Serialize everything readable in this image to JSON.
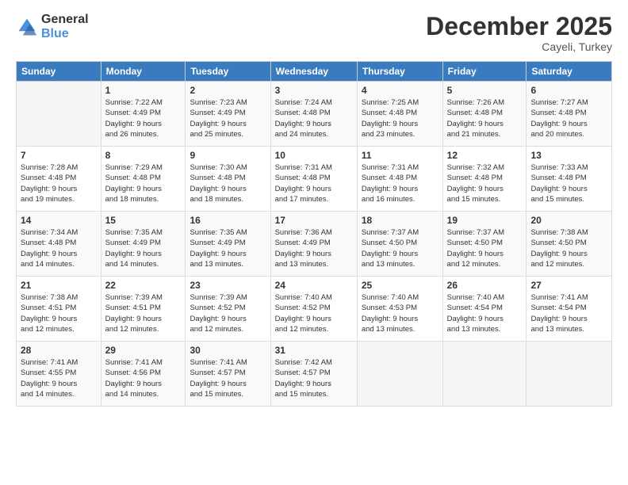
{
  "logo": {
    "general": "General",
    "blue": "Blue"
  },
  "header": {
    "title": "December 2025",
    "location": "Cayeli, Turkey"
  },
  "columns": [
    "Sunday",
    "Monday",
    "Tuesday",
    "Wednesday",
    "Thursday",
    "Friday",
    "Saturday"
  ],
  "weeks": [
    [
      {
        "day": "",
        "sunrise": "",
        "sunset": "",
        "daylight": ""
      },
      {
        "day": "1",
        "sunrise": "7:22 AM",
        "sunset": "4:49 PM",
        "daylight": "9 hours and 26 minutes."
      },
      {
        "day": "2",
        "sunrise": "7:23 AM",
        "sunset": "4:49 PM",
        "daylight": "9 hours and 25 minutes."
      },
      {
        "day": "3",
        "sunrise": "7:24 AM",
        "sunset": "4:48 PM",
        "daylight": "9 hours and 24 minutes."
      },
      {
        "day": "4",
        "sunrise": "7:25 AM",
        "sunset": "4:48 PM",
        "daylight": "9 hours and 23 minutes."
      },
      {
        "day": "5",
        "sunrise": "7:26 AM",
        "sunset": "4:48 PM",
        "daylight": "9 hours and 21 minutes."
      },
      {
        "day": "6",
        "sunrise": "7:27 AM",
        "sunset": "4:48 PM",
        "daylight": "9 hours and 20 minutes."
      }
    ],
    [
      {
        "day": "7",
        "sunrise": "7:28 AM",
        "sunset": "4:48 PM",
        "daylight": "9 hours and 19 minutes."
      },
      {
        "day": "8",
        "sunrise": "7:29 AM",
        "sunset": "4:48 PM",
        "daylight": "9 hours and 18 minutes."
      },
      {
        "day": "9",
        "sunrise": "7:30 AM",
        "sunset": "4:48 PM",
        "daylight": "9 hours and 18 minutes."
      },
      {
        "day": "10",
        "sunrise": "7:31 AM",
        "sunset": "4:48 PM",
        "daylight": "9 hours and 17 minutes."
      },
      {
        "day": "11",
        "sunrise": "7:31 AM",
        "sunset": "4:48 PM",
        "daylight": "9 hours and 16 minutes."
      },
      {
        "day": "12",
        "sunrise": "7:32 AM",
        "sunset": "4:48 PM",
        "daylight": "9 hours and 15 minutes."
      },
      {
        "day": "13",
        "sunrise": "7:33 AM",
        "sunset": "4:48 PM",
        "daylight": "9 hours and 15 minutes."
      }
    ],
    [
      {
        "day": "14",
        "sunrise": "7:34 AM",
        "sunset": "4:48 PM",
        "daylight": "9 hours and 14 minutes."
      },
      {
        "day": "15",
        "sunrise": "7:35 AM",
        "sunset": "4:49 PM",
        "daylight": "9 hours and 14 minutes."
      },
      {
        "day": "16",
        "sunrise": "7:35 AM",
        "sunset": "4:49 PM",
        "daylight": "9 hours and 13 minutes."
      },
      {
        "day": "17",
        "sunrise": "7:36 AM",
        "sunset": "4:49 PM",
        "daylight": "9 hours and 13 minutes."
      },
      {
        "day": "18",
        "sunrise": "7:37 AM",
        "sunset": "4:50 PM",
        "daylight": "9 hours and 13 minutes."
      },
      {
        "day": "19",
        "sunrise": "7:37 AM",
        "sunset": "4:50 PM",
        "daylight": "9 hours and 12 minutes."
      },
      {
        "day": "20",
        "sunrise": "7:38 AM",
        "sunset": "4:50 PM",
        "daylight": "9 hours and 12 minutes."
      }
    ],
    [
      {
        "day": "21",
        "sunrise": "7:38 AM",
        "sunset": "4:51 PM",
        "daylight": "9 hours and 12 minutes."
      },
      {
        "day": "22",
        "sunrise": "7:39 AM",
        "sunset": "4:51 PM",
        "daylight": "9 hours and 12 minutes."
      },
      {
        "day": "23",
        "sunrise": "7:39 AM",
        "sunset": "4:52 PM",
        "daylight": "9 hours and 12 minutes."
      },
      {
        "day": "24",
        "sunrise": "7:40 AM",
        "sunset": "4:52 PM",
        "daylight": "9 hours and 12 minutes."
      },
      {
        "day": "25",
        "sunrise": "7:40 AM",
        "sunset": "4:53 PM",
        "daylight": "9 hours and 13 minutes."
      },
      {
        "day": "26",
        "sunrise": "7:40 AM",
        "sunset": "4:54 PM",
        "daylight": "9 hours and 13 minutes."
      },
      {
        "day": "27",
        "sunrise": "7:41 AM",
        "sunset": "4:54 PM",
        "daylight": "9 hours and 13 minutes."
      }
    ],
    [
      {
        "day": "28",
        "sunrise": "7:41 AM",
        "sunset": "4:55 PM",
        "daylight": "9 hours and 14 minutes."
      },
      {
        "day": "29",
        "sunrise": "7:41 AM",
        "sunset": "4:56 PM",
        "daylight": "9 hours and 14 minutes."
      },
      {
        "day": "30",
        "sunrise": "7:41 AM",
        "sunset": "4:57 PM",
        "daylight": "9 hours and 15 minutes."
      },
      {
        "day": "31",
        "sunrise": "7:42 AM",
        "sunset": "4:57 PM",
        "daylight": "9 hours and 15 minutes."
      },
      {
        "day": "",
        "sunrise": "",
        "sunset": "",
        "daylight": ""
      },
      {
        "day": "",
        "sunrise": "",
        "sunset": "",
        "daylight": ""
      },
      {
        "day": "",
        "sunrise": "",
        "sunset": "",
        "daylight": ""
      }
    ]
  ],
  "labels": {
    "sunrise": "Sunrise:",
    "sunset": "Sunset:",
    "daylight": "Daylight:"
  }
}
